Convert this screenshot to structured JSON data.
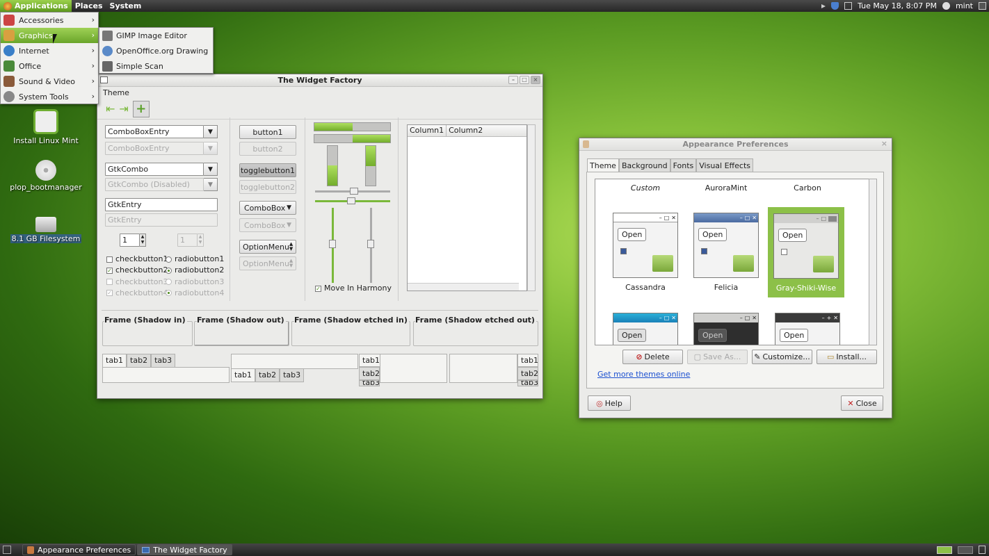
{
  "top_panel": {
    "menus": [
      "Applications",
      "Places",
      "System"
    ],
    "clock": "Tue May 18,  8:07 PM",
    "user": "mint"
  },
  "app_menu": {
    "items": [
      {
        "label": "Accessories"
      },
      {
        "label": "Graphics"
      },
      {
        "label": "Internet"
      },
      {
        "label": "Office"
      },
      {
        "label": "Sound & Video"
      },
      {
        "label": "System Tools"
      }
    ],
    "graphics_submenu": [
      "GIMP Image Editor",
      "OpenOffice.org Drawing",
      "Simple Scan"
    ]
  },
  "desktop_icons": [
    {
      "label": "Install Linux Mint"
    },
    {
      "label": "plop_bootmanager"
    },
    {
      "label": "8.1 GB Filesystem"
    }
  ],
  "widget_factory": {
    "title": "The Widget Factory",
    "menu": "Theme",
    "combos": {
      "cbe": "ComboBoxEntry",
      "cbe_dis": "ComboBoxEntry",
      "gtkcombo": "GtkCombo",
      "gtkcombo_dis": "GtkCombo (Disabled)",
      "entry": "GtkEntry",
      "entry_dis": "GtkEntry"
    },
    "spin": {
      "value": "1",
      "value_dis": "1"
    },
    "checks": [
      "checkbutton1",
      "checkbutton2",
      "checkbutton3",
      "checkbutton4"
    ],
    "radios": [
      "radiobutton1",
      "radiobutton2",
      "radiobutton3",
      "radiobutton4"
    ],
    "buttons": {
      "b1": "button1",
      "b2": "button2",
      "t1": "togglebutton1",
      "t2": "togglebutton2",
      "cb": "ComboBox",
      "cb_dis": "ComboBox",
      "om": "OptionMenu",
      "om_dis": "OptionMenu"
    },
    "harmony": "Move In Harmony",
    "columns": [
      "Column1",
      "Column2"
    ],
    "frames": [
      "Frame (Shadow in)",
      "Frame (Shadow out)",
      "Frame (Shadow etched in)",
      "Frame (Shadow etched out)"
    ],
    "tabs": [
      "tab1",
      "tab2",
      "tab3"
    ],
    "tab3_cut": "tab3"
  },
  "appearance": {
    "title": "Appearance Preferences",
    "tabs": [
      "Theme",
      "Background",
      "Fonts",
      "Visual Effects"
    ],
    "top_row": [
      "Custom",
      "AuroraMint",
      "Carbon"
    ],
    "themes": [
      "Cassandra",
      "Felicia",
      "Gray-Shiki-Wise"
    ],
    "preview_open": "Open",
    "buttons": {
      "delete": "Delete",
      "save": "Save As...",
      "customize": "Customize...",
      "install": "Install..."
    },
    "more_link": "Get more themes online",
    "help": "Help",
    "close": "Close"
  },
  "taskbar": {
    "tasks": [
      "Appearance Preferences",
      "The Widget Factory"
    ]
  },
  "colors": {
    "accent": "#7ab83a",
    "panel": "#2e2e2e"
  }
}
